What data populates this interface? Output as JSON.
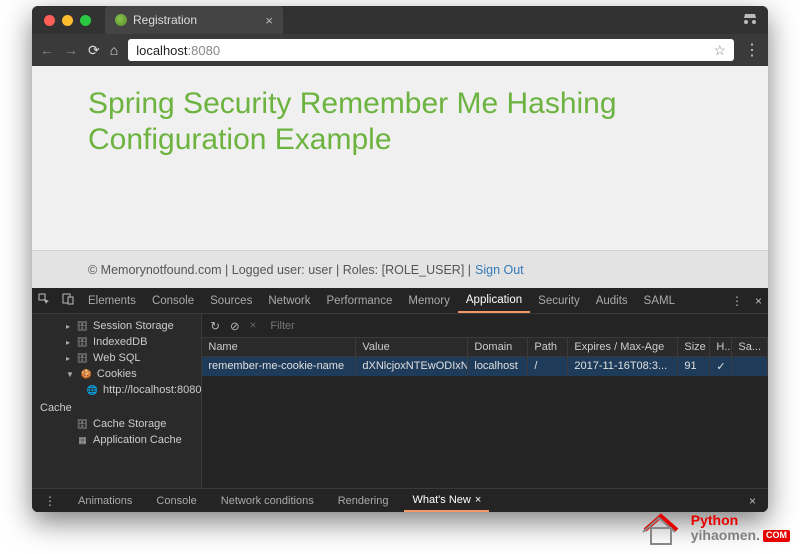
{
  "tab": {
    "title": "Registration"
  },
  "url": {
    "host": "localhost",
    "port": ":8080"
  },
  "page": {
    "heading": "Spring Security Remember Me Hashing Configuration Example",
    "footer": "© Memorynotfound.com | Logged user: user | Roles: [ROLE_USER] |",
    "signout": "Sign Out"
  },
  "devtabs": [
    "Elements",
    "Console",
    "Sources",
    "Network",
    "Performance",
    "Memory",
    "Application",
    "Security",
    "Audits",
    "SAML"
  ],
  "devtab_active": "Application",
  "sidebar": {
    "items": [
      {
        "t": "item",
        "label": "Session Storage",
        "icon": "db"
      },
      {
        "t": "item",
        "label": "IndexedDB",
        "icon": "db"
      },
      {
        "t": "item",
        "label": "Web SQL",
        "icon": "db"
      },
      {
        "t": "item",
        "label": "Cookies",
        "icon": "cookie",
        "caret": "▼"
      },
      {
        "t": "sub",
        "label": "http://localhost:8080",
        "icon": "globe"
      }
    ],
    "cache_label": "Cache",
    "cache": [
      {
        "label": "Cache Storage",
        "icon": "db"
      },
      {
        "label": "Application Cache",
        "icon": "grid"
      }
    ]
  },
  "filter_placeholder": "Filter",
  "columns": {
    "name": "Name",
    "value": "Value",
    "domain": "Domain",
    "path": "Path",
    "expires": "Expires / Max-Age",
    "size": "Size",
    "http": "H...",
    "same": "Sa..."
  },
  "row": {
    "name": "remember-me-cookie-name",
    "value": "dXNlcjoxNTEwODIxN...",
    "domain": "localhost",
    "path": "/",
    "expires": "2017-11-16T08:3...",
    "size": "91",
    "http": "✓",
    "same": ""
  },
  "drawer": [
    "Animations",
    "Console",
    "Network conditions",
    "Rendering",
    "What's New"
  ],
  "drawer_active": "What's New",
  "watermark": {
    "py": "Python",
    "yi": "yihaomen.",
    "com": "COM"
  }
}
